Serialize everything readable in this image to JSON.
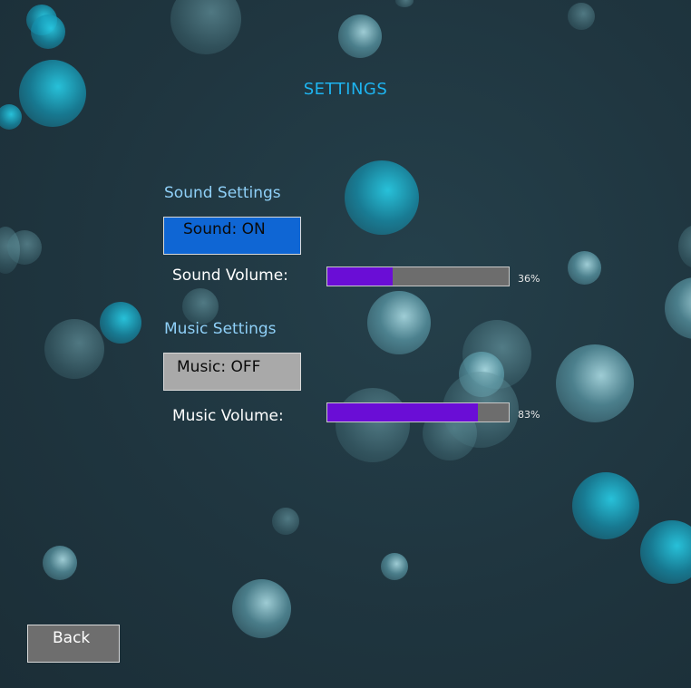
{
  "title": "SETTINGS",
  "sound": {
    "section_label": "Sound Settings",
    "toggle_label": "Sound: ON",
    "volume_label": "Sound Volume:",
    "volume_percent": 36,
    "volume_text": "36%"
  },
  "music": {
    "section_label": "Music Settings",
    "toggle_label": "Music: OFF",
    "volume_label": "Music Volume:",
    "volume_percent": 83,
    "volume_text": "83%"
  },
  "back_label": "Back",
  "colors": {
    "title": "#1eb4f0",
    "section_label": "#8fd0f8",
    "toggle_on": "#0f66d4",
    "toggle_off": "#a9a9a9",
    "slider_fill": "#6a0dd6",
    "slider_track": "#6d6d6d"
  }
}
